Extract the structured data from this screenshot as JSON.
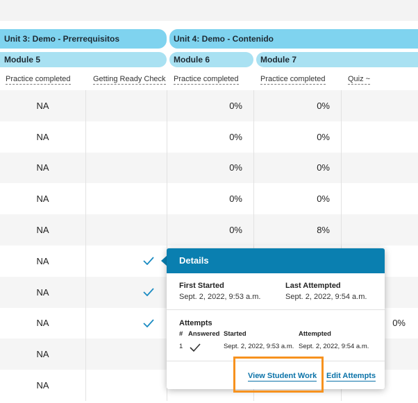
{
  "units": [
    {
      "label": "Unit 3: Demo - Prerrequisitos"
    },
    {
      "label": "Unit 4: Demo - Contenido"
    }
  ],
  "modules": [
    {
      "label": "Module 5"
    },
    {
      "label": "Module 6"
    },
    {
      "label": "Module 7"
    }
  ],
  "columns": [
    "Practice completed",
    "Getting Ready Check",
    "Practice completed",
    "Practice completed",
    "Quiz ~"
  ],
  "rows": [
    {
      "c1": "NA",
      "c2": "",
      "c3": "0%",
      "c4": "0%",
      "c5": ""
    },
    {
      "c1": "NA",
      "c2": "",
      "c3": "0%",
      "c4": "0%",
      "c5": ""
    },
    {
      "c1": "NA",
      "c2": "",
      "c3": "0%",
      "c4": "0%",
      "c5": ""
    },
    {
      "c1": "NA",
      "c2": "",
      "c3": "0%",
      "c4": "0%",
      "c5": ""
    },
    {
      "c1": "NA",
      "c2": "",
      "c3": "0%",
      "c4": "8%",
      "c5": ""
    },
    {
      "c1": "NA",
      "c2": "check",
      "c3": "",
      "c4": "",
      "c5": ""
    },
    {
      "c1": "NA",
      "c2": "check",
      "c3": "",
      "c4": "",
      "c5": ""
    },
    {
      "c1": "NA",
      "c2": "check",
      "c3": "",
      "c4": "",
      "c5": "0%"
    },
    {
      "c1": "NA",
      "c2": "",
      "c3": "",
      "c4": "",
      "c5": ""
    },
    {
      "c1": "NA",
      "c2": "",
      "c3": "",
      "c4": "",
      "c5": ""
    }
  ],
  "popup": {
    "title": "Details",
    "first_started_label": "First Started",
    "first_started_value": "Sept. 2, 2022, 9:53 a.m.",
    "last_attempted_label": "Last Attempted",
    "last_attempted_value": "Sept. 2, 2022, 9:54 a.m.",
    "attempts_label": "Attempts",
    "attempts_headers": {
      "num": "#",
      "answered": "Answered",
      "started": "Started",
      "attempted": "Attempted"
    },
    "attempts": [
      {
        "num": "1",
        "answered": "check",
        "started": "Sept. 2, 2022, 9:53 a.m.",
        "attempted": "Sept. 2, 2022, 9:54 a.m."
      }
    ],
    "view_student_work": "View Student Work",
    "edit_attempts": "Edit Attempts"
  },
  "colors": {
    "accent": "#0a7fb0",
    "unit_pill": "#7fd3ef",
    "module_pill": "#a9e1f2",
    "highlight": "#f7921e"
  }
}
